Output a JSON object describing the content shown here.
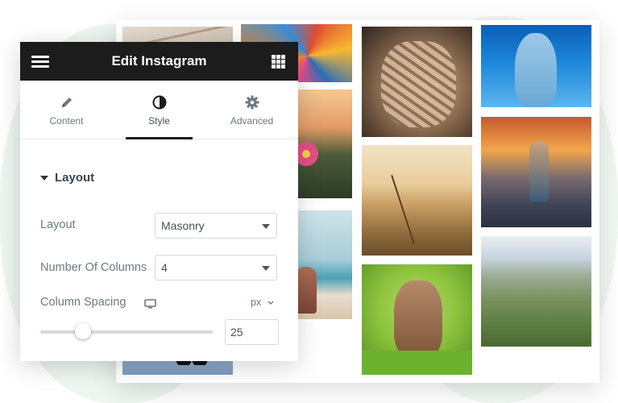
{
  "panel": {
    "title": "Edit Instagram",
    "tabs": [
      {
        "label": "Content",
        "icon": "pencil-icon"
      },
      {
        "label": "Style",
        "icon": "contrast-icon",
        "active": true
      },
      {
        "label": "Advanced",
        "icon": "gear-icon"
      }
    ],
    "section": {
      "title": "Layout",
      "expanded": true
    },
    "controls": {
      "layout": {
        "label": "Layout",
        "value": "Masonry"
      },
      "columns": {
        "label": "Number Of Columns",
        "value": "4"
      },
      "spacing": {
        "label": "Column Spacing",
        "unit": "px",
        "value": "25",
        "slider_fraction": 0.25,
        "device_icon": "desktop-icon"
      }
    }
  },
  "gallery": {
    "images": [
      "bridge-photo",
      "umbrellas-photo",
      "flower-photo",
      "beach-photo",
      "sunglasses-photo",
      "rope-knot-photo",
      "wheat-field-photo",
      "rabbit-photo",
      "dolphin-photo",
      "child-sunset-photo",
      "valley-photo"
    ]
  },
  "colors": {
    "header_bg": "#1c1c1c",
    "accent": "#1c1c1c",
    "muted_text": "#6d7882"
  }
}
